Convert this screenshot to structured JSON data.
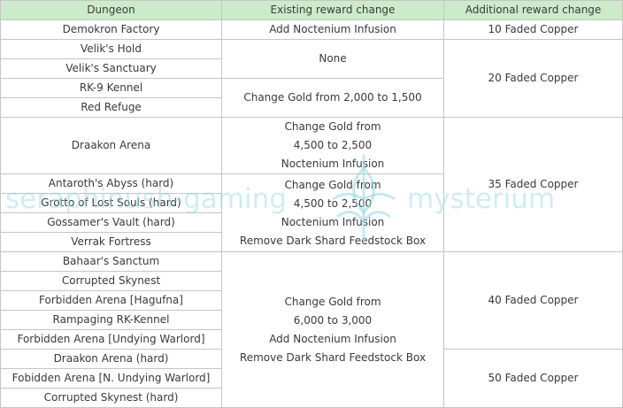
{
  "headers": {
    "dungeon": "Dungeon",
    "existing": "Existing reward change",
    "additional": "Additional reward change"
  },
  "dungeons": [
    "Demokron Factory",
    "Velik's Hold",
    "Velik's Sanctuary",
    "RK-9 Kennel",
    "Red Refuge",
    "Draakon Arena",
    "Antaroth's Abyss (hard)",
    "Grotto of Lost Souls (hard)",
    "Gossamer's Vault (hard)",
    "Verrak Fortress",
    "Bahaar's Sanctum",
    "Corrupted Skynest",
    "Forbidden Arena [Hagufna]",
    "Rampaging RK-Kennel",
    "Forbidden Arena [Undying Warlord]",
    "Draakon Arena (hard)",
    "Fobidden Arena [N. Undying Warlord]",
    "Corrupted Skynest (hard)"
  ],
  "existing_changes": {
    "demokron": "Add Noctenium Infusion",
    "velik": "None",
    "rk9": "Change Gold from 2,000 to 1,500",
    "draakon": [
      "Change Gold from",
      "4,500 to 2,500",
      "Noctenium Infusion"
    ],
    "group_hard": [
      "Change Gold from",
      "4,500 to 2,500",
      "Noctenium Infusion",
      "Remove Dark Shard Feedstock Box"
    ],
    "group_late": [
      "Change Gold from",
      "6,000 to 3,000",
      "Add Noctenium Infusion",
      "Remove Dark Shard Feedstock Box"
    ]
  },
  "additional_changes": {
    "demokron": "10 Faded Copper",
    "velik_rk": "20 Faded Copper",
    "draakon_group": "35 Faded Copper",
    "late_group": "40 Faded Copper",
    "final_group": "50 Faded Copper"
  },
  "watermark": {
    "left_text": "seraphinush-gaming",
    "right_text": "mysterium"
  }
}
